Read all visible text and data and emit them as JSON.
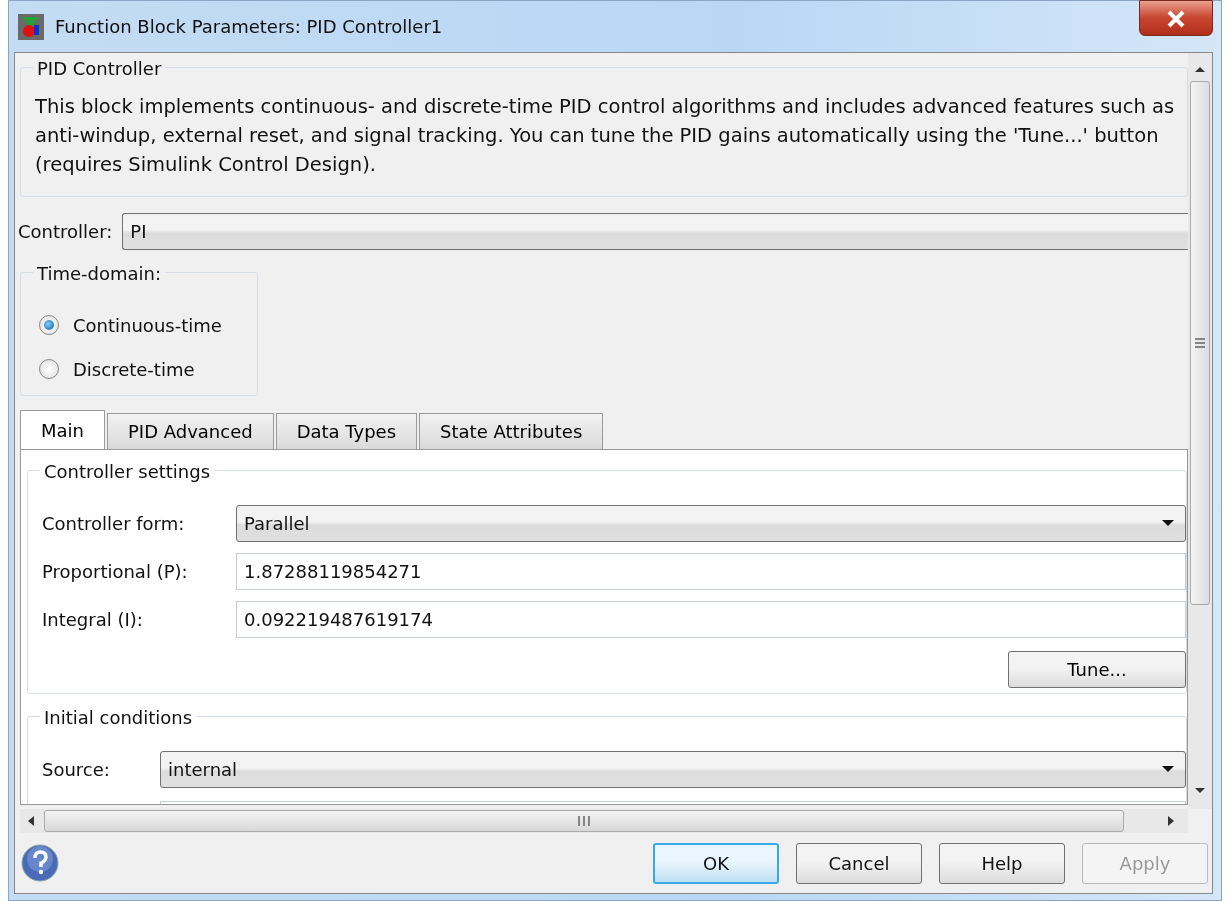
{
  "window": {
    "title": "Function Block Parameters: PID Controller1"
  },
  "description": {
    "title": "PID Controller",
    "text": "This block implements continuous- and discrete-time PID control algorithms and includes advanced features such as anti-windup, external reset, and signal tracking. You can tune the PID gains automatically using the 'Tune...' button (requires Simulink Control Design)."
  },
  "controller": {
    "label": "Controller:",
    "value": "PI"
  },
  "time_domain": {
    "title": "Time-domain:",
    "options": [
      {
        "label": "Continuous-time",
        "selected": true
      },
      {
        "label": "Discrete-time",
        "selected": false
      }
    ]
  },
  "tabs": [
    {
      "label": "Main",
      "selected": true
    },
    {
      "label": "PID Advanced",
      "selected": false
    },
    {
      "label": "Data Types",
      "selected": false
    },
    {
      "label": "State Attributes",
      "selected": false
    }
  ],
  "controller_settings": {
    "title": "Controller settings",
    "fields": [
      {
        "kind": "dropdown",
        "label": "Controller form:",
        "value": "Parallel"
      },
      {
        "kind": "text",
        "label": "Proportional (P):",
        "value": "1.87288119854271"
      },
      {
        "kind": "text",
        "label": "Integral (I):",
        "value": "0.092219487619174"
      }
    ],
    "button": "Tune..."
  },
  "initial_conditions": {
    "title": "Initial conditions",
    "fields": [
      {
        "kind": "dropdown",
        "label": "Source:",
        "value": "internal"
      }
    ]
  },
  "buttons": [
    {
      "label": "OK",
      "default": true,
      "disabled": false
    },
    {
      "label": "Cancel",
      "default": false,
      "disabled": false
    },
    {
      "label": "Help",
      "default": false,
      "disabled": false
    },
    {
      "label": "Apply",
      "default": false,
      "disabled": true
    }
  ]
}
